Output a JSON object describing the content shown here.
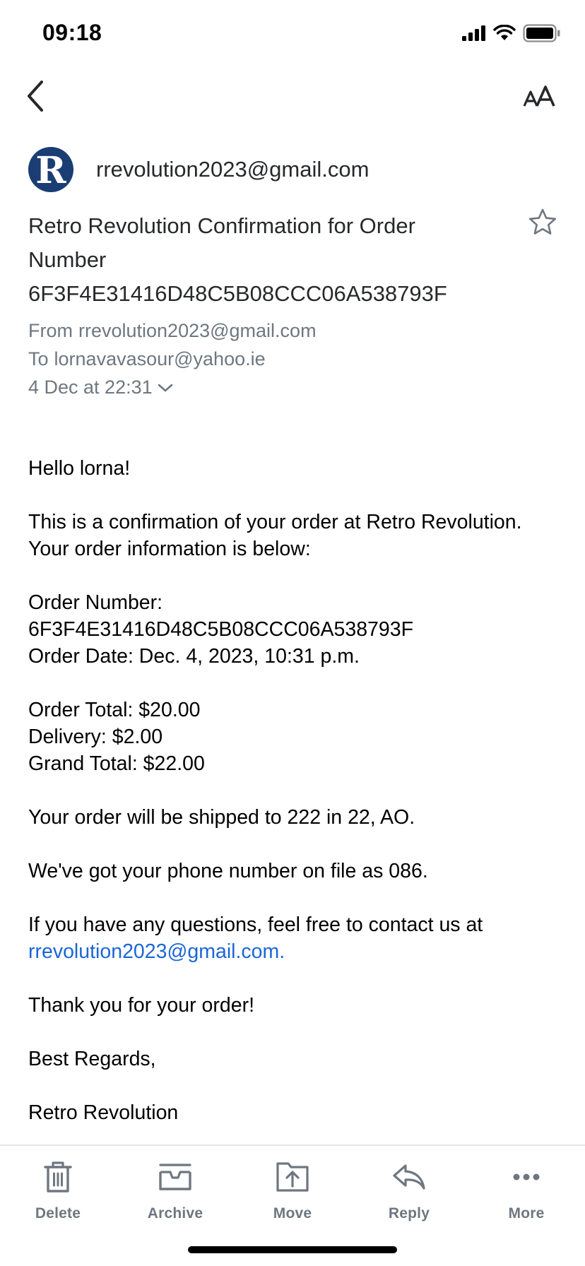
{
  "status_bar": {
    "time": "09:18",
    "icons": [
      "signal-icon",
      "wifi-icon",
      "battery-icon"
    ]
  },
  "nav": {
    "back_icon": "chevron-left-icon",
    "text_size_label": "AA"
  },
  "email": {
    "sender_initial": "R",
    "sender_name": "rrevolution2023@gmail.com",
    "subject_lines": [
      "Retro Revolution Confirmation for Order",
      "Number",
      "6F3F4E31416D48C5B08CCC06A538793F"
    ],
    "from_label": "From",
    "from_value": "rrevolution2023@gmail.com",
    "to_label": "To",
    "to_value": "lornavavasour@yahoo.ie",
    "date": "4 Dec at 22:31"
  },
  "body": {
    "greeting": "Hello lorna!",
    "intro_lines": [
      "This is a confirmation of your order at Retro Revolution.",
      "Your order information is below:"
    ],
    "order_number_label": "Order Number:",
    "order_number": "6F3F4E31416D48C5B08CCC06A538793F",
    "order_date": "Order Date: Dec. 4, 2023, 10:31 p.m.",
    "order_total": "Order Total: $20.00",
    "delivery": "Delivery: $2.00",
    "grand_total": "Grand Total: $22.00",
    "shipping": "Your order will be shipped to 222 in 22, AO.",
    "phone": "We've got your phone number on file as 086.",
    "questions": "If you have any questions, feel free to contact us at",
    "contact_link": "rrevolution2023@gmail.com.",
    "thanks": "Thank you for your order!",
    "regards": "Best Regards,",
    "signature": "Retro Revolution"
  },
  "toolbar": {
    "delete": "Delete",
    "archive": "Archive",
    "move": "Move",
    "reply": "Reply",
    "more": "More"
  },
  "colors": {
    "avatar_bg": "#1a3d73",
    "link": "#1a66d6",
    "meta_text": "#6e7780",
    "icon_gray": "#6e7780"
  }
}
